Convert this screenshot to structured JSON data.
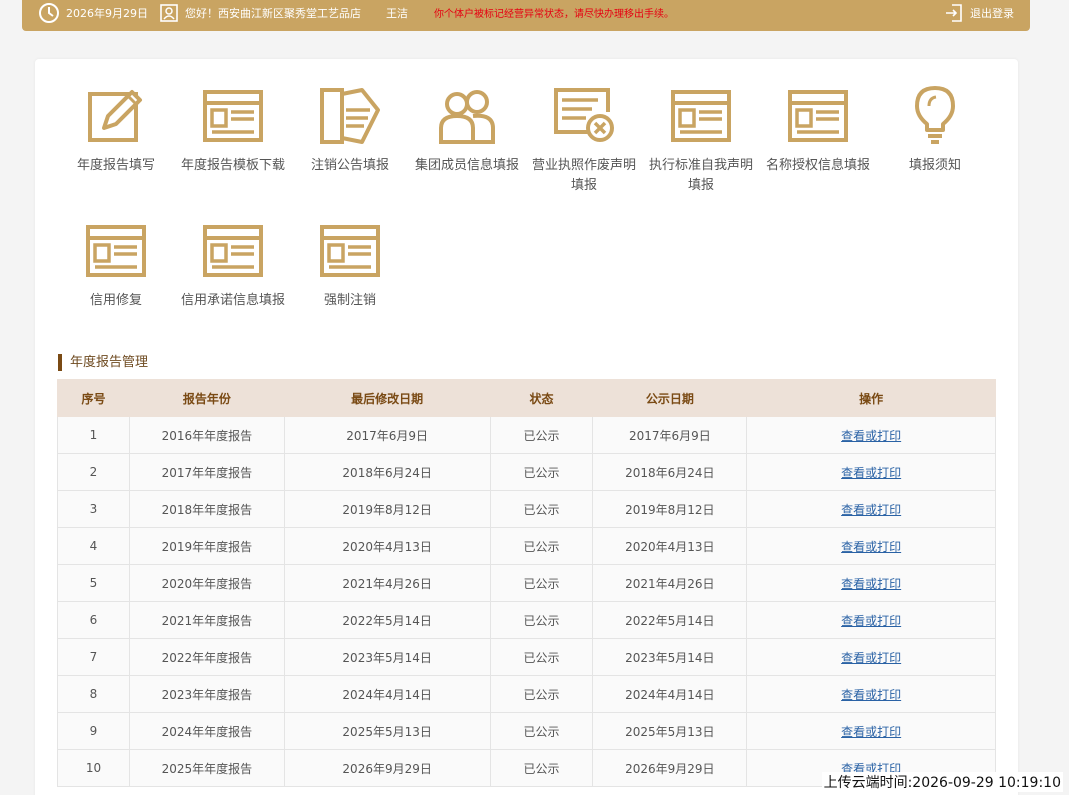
{
  "header": {
    "date": "2026年9月29日",
    "greeting": "您好！西安曲江新区聚秀堂工艺品店",
    "user": "王洁",
    "warning": "你个体户被标记经营异常状态，请尽快办理移出手续。",
    "logout_label": "退出登录"
  },
  "tiles": [
    {
      "label": "年度报告填写",
      "icon": "edit-icon"
    },
    {
      "label": "年度报告模板下载",
      "icon": "template-icon"
    },
    {
      "label": "注销公告填报",
      "icon": "cancel-notice-icon"
    },
    {
      "label": "集团成员信息填报",
      "icon": "group-members-icon"
    },
    {
      "label": "营业执照作废声明填报",
      "icon": "license-void-icon"
    },
    {
      "label": "执行标准自我声明填报",
      "icon": "standard-icon"
    },
    {
      "label": "名称授权信息填报",
      "icon": "name-auth-icon"
    },
    {
      "label": "填报须知",
      "icon": "lightbulb-icon"
    },
    {
      "label": "信用修复",
      "icon": "credit-repair-icon"
    },
    {
      "label": "信用承诺信息填报",
      "icon": "credit-promise-icon"
    },
    {
      "label": "强制注销",
      "icon": "forced-cancel-icon"
    }
  ],
  "section_title": "年度报告管理",
  "table": {
    "headers": [
      "序号",
      "报告年份",
      "最后修改日期",
      "状态",
      "公示日期",
      "操作"
    ],
    "rows": [
      [
        "1",
        "2016年年度报告",
        "2017年6月9日",
        "已公示",
        "2017年6月9日",
        "查看或打印"
      ],
      [
        "2",
        "2017年年度报告",
        "2018年6月24日",
        "已公示",
        "2018年6月24日",
        "查看或打印"
      ],
      [
        "3",
        "2018年年度报告",
        "2019年8月12日",
        "已公示",
        "2019年8月12日",
        "查看或打印"
      ],
      [
        "4",
        "2019年年度报告",
        "2020年4月13日",
        "已公示",
        "2020年4月13日",
        "查看或打印"
      ],
      [
        "5",
        "2020年年度报告",
        "2021年4月26日",
        "已公示",
        "2021年4月26日",
        "查看或打印"
      ],
      [
        "6",
        "2021年年度报告",
        "2022年5月14日",
        "已公示",
        "2022年5月14日",
        "查看或打印"
      ],
      [
        "7",
        "2022年年度报告",
        "2023年5月14日",
        "已公示",
        "2023年5月14日",
        "查看或打印"
      ],
      [
        "8",
        "2023年年度报告",
        "2024年4月14日",
        "已公示",
        "2024年4月14日",
        "查看或打印"
      ],
      [
        "9",
        "2024年年度报告",
        "2025年5月13日",
        "已公示",
        "2025年5月13日",
        "查看或打印"
      ],
      [
        "10",
        "2025年年度报告",
        "2026年9月29日",
        "已公示",
        "2026年9月29日",
        "查看或打印"
      ]
    ]
  },
  "upload_stamp": "上传云端时间:2026-09-29 10:19:10",
  "colors": {
    "gold": "#c9a462",
    "brown": "#7a4a14",
    "warning": "#e60012",
    "link": "#2a62a5"
  }
}
